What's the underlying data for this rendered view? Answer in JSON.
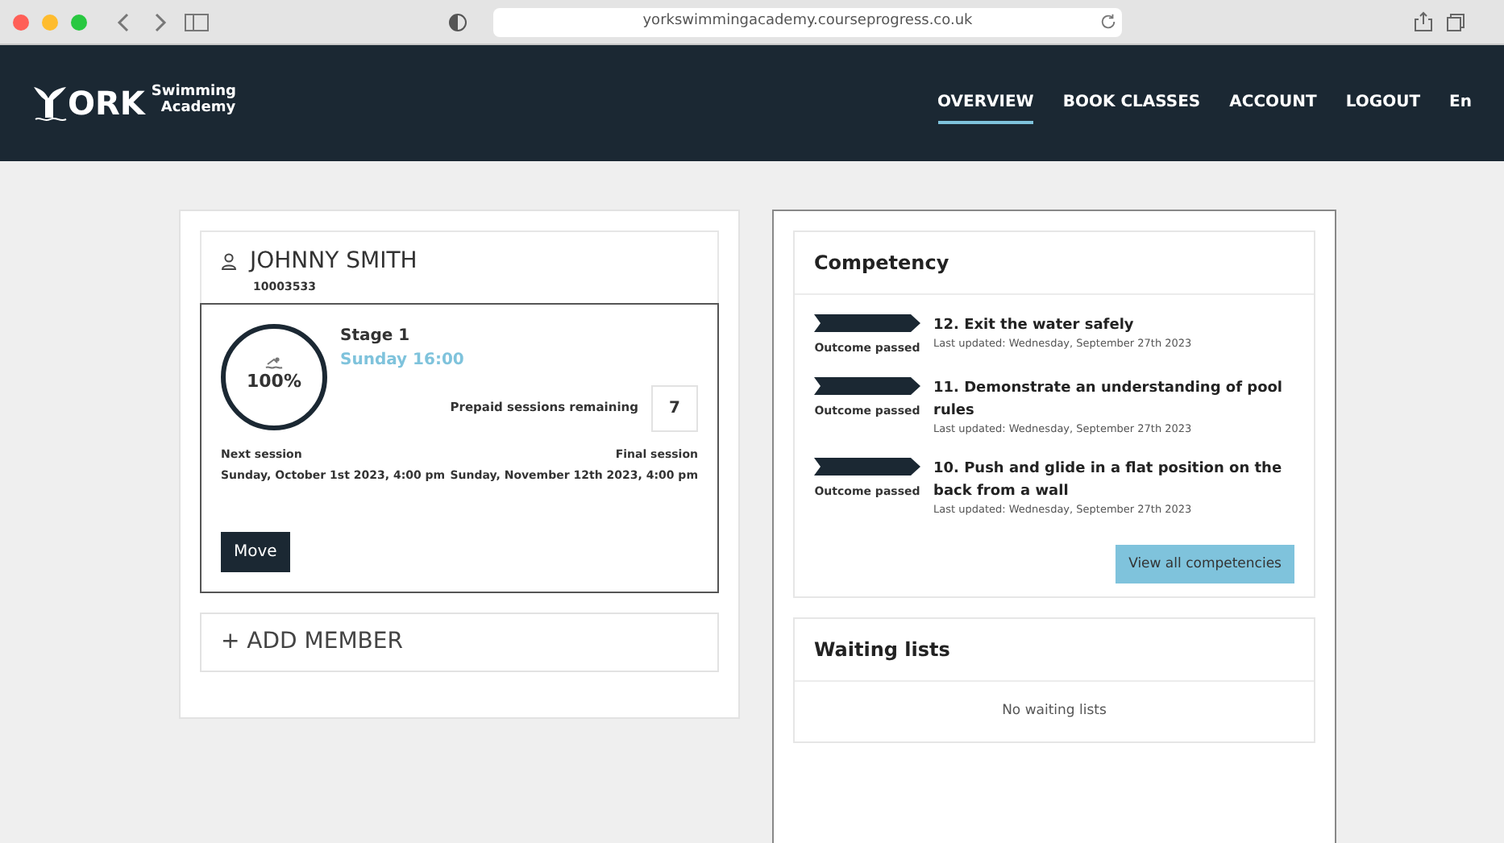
{
  "browser": {
    "url": "yorkswimmingacademy.courseprogress.co.uk"
  },
  "logo": {
    "mark": "ORK",
    "line1": "Swimming",
    "line2": "Academy"
  },
  "nav": [
    {
      "label": "OVERVIEW",
      "selected": true
    },
    {
      "label": "BOOK CLASSES",
      "selected": false
    },
    {
      "label": "ACCOUNT",
      "selected": false
    },
    {
      "label": "LOGOUT",
      "selected": false
    },
    {
      "label": "En",
      "selected": false
    }
  ],
  "member": {
    "name": "JOHNNY SMITH",
    "id": "10003533",
    "progress": "100%",
    "stage": "Stage 1",
    "time": "Sunday 16:00",
    "prepaid_label": "Prepaid sessions remaining",
    "prepaid_value": "7",
    "next_label": "Next session",
    "next_value": "Sunday, October 1st 2023, 4:00 pm",
    "final_label": "Final session",
    "final_value": "Sunday, November 12th 2023, 4:00 pm",
    "move_button": "Move"
  },
  "add_member": "+ ADD MEMBER",
  "competency": {
    "title": "Competency",
    "items": [
      {
        "outcome": "Outcome passed",
        "title": "12. Exit the water safely",
        "updated": "Last updated: Wednesday, September 27th 2023"
      },
      {
        "outcome": "Outcome passed",
        "title": "11. Demonstrate an understanding of pool rules",
        "updated": "Last updated: Wednesday, September 27th 2023"
      },
      {
        "outcome": "Outcome passed",
        "title": "10. Push and glide in a flat position on the back from a wall",
        "updated": "Last updated: Wednesday, September 27th 2023"
      }
    ],
    "button": "View all competencies"
  },
  "waiting_lists": {
    "title": "Waiting lists",
    "empty": "No waiting lists"
  }
}
